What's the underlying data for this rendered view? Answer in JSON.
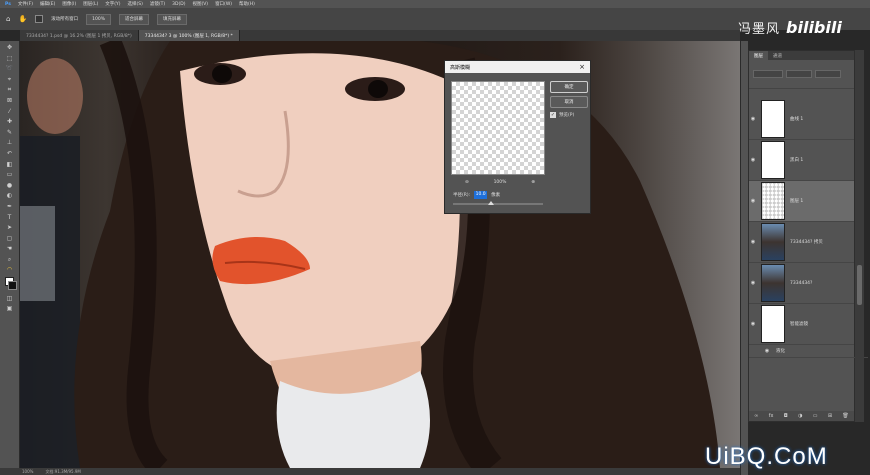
{
  "menubar": {
    "items": [
      "文件(F)",
      "编辑(E)",
      "图像(I)",
      "图层(L)",
      "文字(Y)",
      "选择(S)",
      "滤镜(T)",
      "3D(D)",
      "视图(V)",
      "窗口(W)",
      "帮助(H)"
    ]
  },
  "options": {
    "scroll_all_label": "滚动所有窗口",
    "zoom_value": "100%",
    "fit_screen_label": "适合屏幕",
    "fill_screen_label": "填充屏幕"
  },
  "tabs": [
    {
      "label": "7334434? 1.psd @ 16.2% (图层 1 拷贝, RGB/8*)",
      "active": false
    },
    {
      "label": "7334434? 3 @ 100% (图层 1, RGB/8*) *",
      "active": true
    }
  ],
  "dialog": {
    "title": "高斯模糊",
    "close": "×",
    "ok_label": "确定",
    "cancel_label": "取消",
    "preview_label": "预览(P)",
    "preview_checked": true,
    "zoom_out": "⊖",
    "zoom_value": "100%",
    "zoom_in": "⊕",
    "radius_label": "半径(R):",
    "radius_value": "10.0",
    "radius_unit": "像素",
    "slider_fraction": 0.42
  },
  "layers_panel": {
    "tabs": [
      "图层",
      "通道"
    ],
    "layers": [
      {
        "name": "曲线 1",
        "selected": false,
        "thumb": "white"
      },
      {
        "name": "黑白 1",
        "selected": false,
        "thumb": "white"
      },
      {
        "name": "图层 1",
        "selected": true,
        "thumb": "checker"
      },
      {
        "name": "7334434? 拷贝",
        "selected": false,
        "thumb": "photo"
      },
      {
        "name": "7334434?",
        "selected": false,
        "thumb": "photo"
      },
      {
        "name": "智能滤镜",
        "selected": false,
        "thumb": "white"
      },
      {
        "name": "液化",
        "selected": false,
        "thumb": "none"
      }
    ]
  },
  "status": {
    "zoom": "100%",
    "doc_info": "文档:91.3M/95.9M"
  },
  "brand": {
    "name_cn": "冯墨风",
    "bilibili": "bilibili"
  },
  "watermark": "UiBQ.CoM",
  "colors": {
    "selection_blue": "#1e6fd9",
    "panel_gray": "#535353",
    "bg_dark": "#282828"
  }
}
